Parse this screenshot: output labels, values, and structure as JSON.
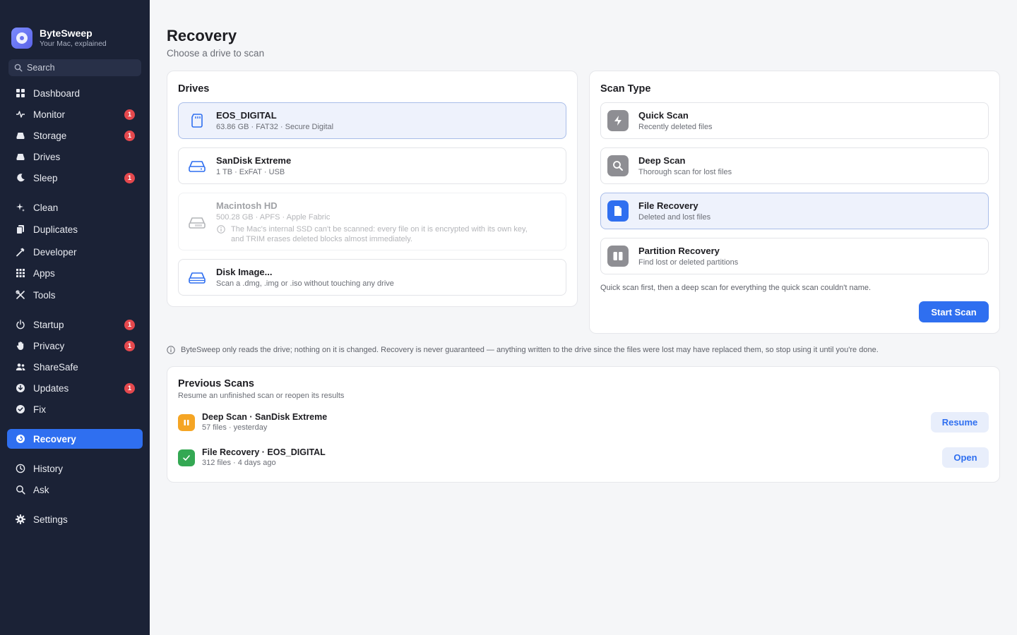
{
  "app": {
    "name": "ByteSweep",
    "tagline": "Your Mac, explained"
  },
  "search": {
    "placeholder": "Search"
  },
  "sidebar": {
    "items": [
      {
        "label": "Dashboard"
      },
      {
        "label": "Monitor",
        "badge": "1"
      },
      {
        "label": "Storage",
        "badge": "1"
      },
      {
        "label": "Drives"
      },
      {
        "label": "Sleep",
        "badge": "1"
      },
      {
        "label": "Clean"
      },
      {
        "label": "Duplicates"
      },
      {
        "label": "Developer"
      },
      {
        "label": "Apps"
      },
      {
        "label": "Tools"
      },
      {
        "label": "Startup",
        "badge": "1"
      },
      {
        "label": "Privacy",
        "badge": "1"
      },
      {
        "label": "ShareSafe"
      },
      {
        "label": "Updates",
        "badge": "1"
      },
      {
        "label": "Fix"
      },
      {
        "label": "Recovery",
        "active": true
      },
      {
        "label": "History"
      },
      {
        "label": "Ask"
      },
      {
        "label": "Settings"
      }
    ]
  },
  "page": {
    "title": "Recovery",
    "subtitle": "Choose a drive to scan"
  },
  "drives": {
    "title": "Drives",
    "items": [
      {
        "name": "EOS_DIGITAL",
        "detail": "63.86 GB · FAT32 · Secure Digital",
        "selected": true
      },
      {
        "name": "SanDisk Extreme",
        "detail": "1 TB · ExFAT · USB"
      },
      {
        "name": "Macintosh HD",
        "detail": "500.28 GB · APFS · Apple Fabric",
        "note": "The Mac's internal SSD can't be scanned: every file on it is encrypted with its own key, and TRIM erases deleted blocks almost immediately.",
        "disabled": true
      },
      {
        "name": "Disk Image...",
        "detail": "Scan a .dmg, .img or .iso without touching any drive"
      }
    ]
  },
  "scan_type": {
    "title": "Scan Type",
    "items": [
      {
        "name": "Quick Scan",
        "detail": "Recently deleted files"
      },
      {
        "name": "Deep Scan",
        "detail": "Thorough scan for lost files"
      },
      {
        "name": "File Recovery",
        "detail": "Deleted and lost files",
        "selected": true
      },
      {
        "name": "Partition Recovery",
        "detail": "Find lost or deleted partitions"
      }
    ],
    "hint": "Quick scan first, then a deep scan for everything the quick scan couldn't name.",
    "start_label": "Start Scan"
  },
  "disclaimer": "ByteSweep only reads the drive; nothing on it is changed. Recovery is never guaranteed — anything written to the drive since the files were lost may have replaced them, so stop using it until you're done.",
  "previous_scans": {
    "title": "Previous Scans",
    "subtitle": "Resume an unfinished scan or reopen its results",
    "items": [
      {
        "title": "Deep Scan · SanDisk Extreme",
        "detail": "57 files · yesterday",
        "status": "paused",
        "action": "Resume"
      },
      {
        "title": "File Recovery · EOS_DIGITAL",
        "detail": "312 files · 4 days ago",
        "status": "complete",
        "action": "Open"
      }
    ]
  },
  "colors": {
    "sidebar": "#1b2236",
    "accent": "#2f6ff0",
    "badge": "#e5484d",
    "paused": "#f5a524",
    "complete": "#34a853"
  }
}
